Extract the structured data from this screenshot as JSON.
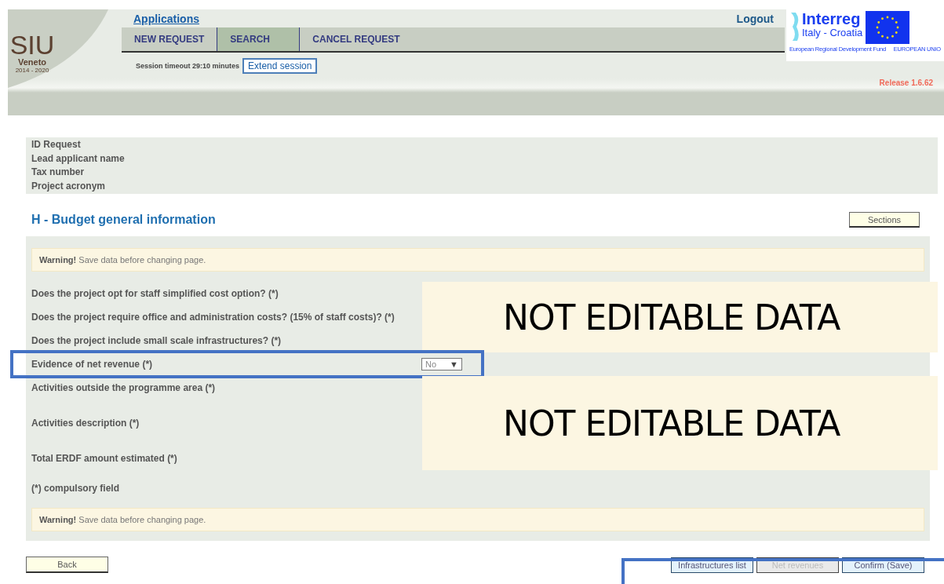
{
  "header": {
    "logo": {
      "title": "SIU",
      "subtitle": "Veneto",
      "years": "2014 - 2020"
    },
    "applications_link": "Applications",
    "logout": "Logout",
    "nav_tabs": [
      {
        "label": "NEW REQUEST",
        "selected": false
      },
      {
        "label": "SEARCH",
        "selected": true
      },
      {
        "label": "CANCEL REQUEST",
        "selected": false
      }
    ],
    "session_text": "Session timeout 29:10 minutes",
    "extend_button": "Extend session",
    "release": "Release 1.6.62",
    "partner_logo": {
      "name": "Interreg",
      "region": "Italy - Croatia",
      "fund": "European Regional Development Fund",
      "union": "EUROPEAN UNIO"
    }
  },
  "request_info": [
    "ID Request",
    "Lead applicant name",
    "Tax number",
    "Project acronym"
  ],
  "section_title": "H - Budget general information",
  "sections_button": "Sections",
  "warning": {
    "label": "Warning!",
    "text": "Save data before changing page."
  },
  "blocks": [
    {
      "kind": "locked",
      "overlay_text": "NOT EDITABLE DATA",
      "rows": [
        {
          "label": "Does the project opt for staff simplified cost option? (*)",
          "kind": "line"
        },
        {
          "label": "Does the project require office and administration costs? (15% of staff costs)? (*)",
          "kind": "line"
        },
        {
          "label": "Does the project include small scale infrastructures? (*)",
          "kind": "line"
        }
      ]
    },
    {
      "kind": "open",
      "rows": [
        {
          "label": "Evidence of net revenue (*)",
          "kind": "select",
          "value": "No",
          "arrow": "▼",
          "highlighted": true
        }
      ]
    },
    {
      "kind": "locked",
      "overlay_text": "NOT EDITABLE DATA",
      "rows": [
        {
          "label": "Activities outside the programme area (*)",
          "kind": "line"
        },
        {
          "label": "Activities description (*)",
          "kind": "multiline"
        },
        {
          "label": "Total ERDF amount estimated (*)",
          "kind": "line"
        }
      ]
    }
  ],
  "compulsory_note": "(*) compulsory field",
  "bottom_warning": {
    "label": "Warning!",
    "text": "Save data before changing page."
  },
  "back_button": "Back",
  "action_buttons": [
    {
      "label": "Infrastructures list",
      "disabled": false
    },
    {
      "label": "Net revenues",
      "disabled": true
    },
    {
      "label": "Confirm (Save)",
      "disabled": false
    }
  ],
  "action_buttons_highlighted": true
}
